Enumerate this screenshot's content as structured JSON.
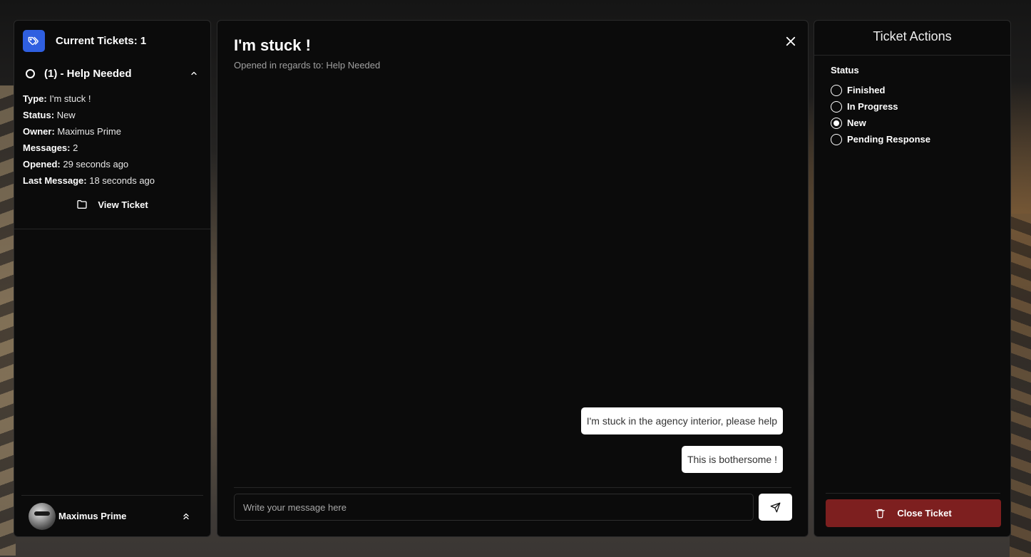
{
  "sidebar": {
    "title": "Current Tickets: 1",
    "ticket": {
      "label": "(1) - Help Needed",
      "details": [
        {
          "key": "Type:",
          "value": "I'm stuck !"
        },
        {
          "key": "Status:",
          "value": "New"
        },
        {
          "key": "Owner:",
          "value": "Maximus Prime"
        },
        {
          "key": "Messages:",
          "value": "2"
        },
        {
          "key": "Opened:",
          "value": "29 seconds ago"
        },
        {
          "key": "Last Message:",
          "value": "18 seconds ago"
        }
      ],
      "view_label": "View Ticket"
    },
    "user": {
      "name": "Maximus Prime"
    }
  },
  "chat": {
    "title": "I'm stuck !",
    "subtitle": "Opened in regards to: Help Needed",
    "messages": [
      "I'm stuck in the agency interior, please help",
      "This is bothersome !"
    ],
    "input_placeholder": "Write your message here"
  },
  "actions": {
    "title": "Ticket Actions",
    "status_label": "Status",
    "options": [
      "Finished",
      "In Progress",
      "New",
      "Pending Response"
    ],
    "selected": "New",
    "close_label": "Close Ticket"
  },
  "colors": {
    "accent_blue": "#2f5fe0",
    "danger_red": "#7d1f1f",
    "panel_bg": "#0b0b0b"
  },
  "icons": {
    "tag": "tags-icon",
    "folder": "folder-icon",
    "close": "close-icon",
    "send": "send-icon",
    "trash": "trash-icon",
    "chevron_up": "chevron-up-icon",
    "double_chevron_up": "chevrons-up-icon"
  }
}
